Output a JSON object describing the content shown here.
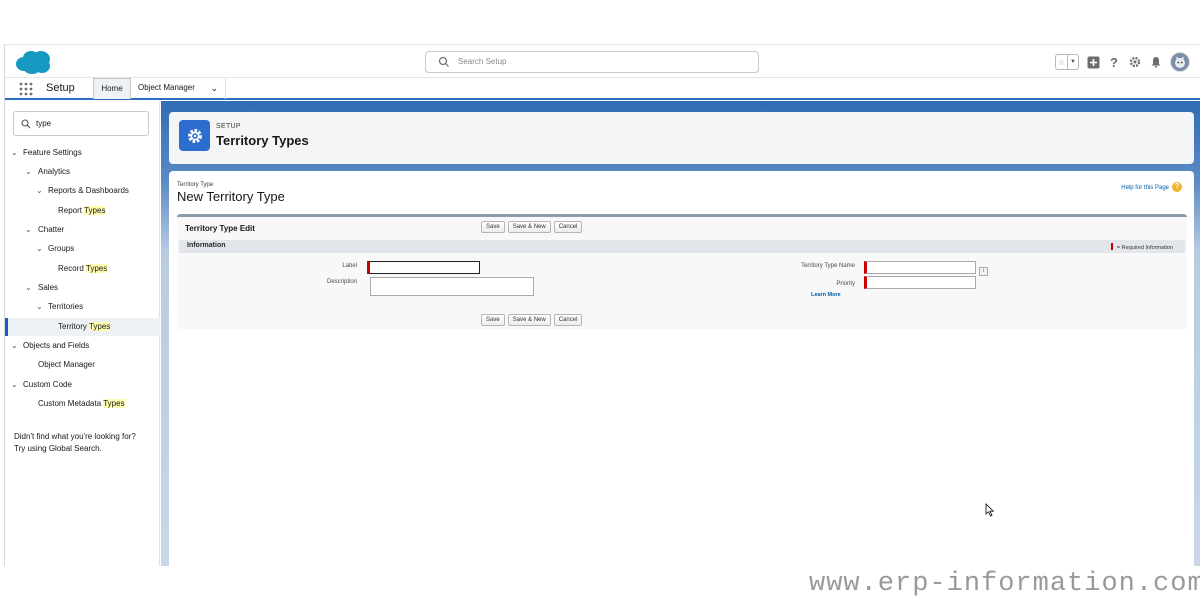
{
  "header": {
    "search_placeholder": "Search Setup",
    "icons": [
      "favorites-star-icon",
      "favorites-dropdown-icon",
      "add-icon",
      "help-icon",
      "settings-gear-icon",
      "notifications-bell-icon",
      "avatar-icon"
    ],
    "help_glyph": "?"
  },
  "context_bar": {
    "app_name": "Setup",
    "tabs": [
      {
        "label": "Home",
        "active": true
      },
      {
        "label": "Object Manager",
        "active": false
      }
    ]
  },
  "sidebar": {
    "quickfind_value": "type",
    "items": [
      {
        "text": "Feature Settings",
        "match": ""
      },
      {
        "text": "Analytics",
        "match": ""
      },
      {
        "text": "Reports & Dashboards",
        "match": ""
      },
      {
        "text": "Report ",
        "match": "Types"
      },
      {
        "text": "Chatter",
        "match": ""
      },
      {
        "text": "Groups",
        "match": ""
      },
      {
        "text": "Record ",
        "match": "Types"
      },
      {
        "text": "Sales",
        "match": ""
      },
      {
        "text": "Territories",
        "match": ""
      },
      {
        "text": "Territory ",
        "match": "Types"
      },
      {
        "text": "Objects and Fields",
        "match": ""
      },
      {
        "text": "Object Manager",
        "match": ""
      },
      {
        "text": "Custom Code",
        "match": ""
      },
      {
        "text": "Custom Metadata ",
        "match": "Types"
      }
    ],
    "not_found_line1": "Didn't find what you're looking for?",
    "not_found_line2": "Try using Global Search."
  },
  "page_header": {
    "eyebrow": "SETUP",
    "title": "Territory Types"
  },
  "record": {
    "type_label": "Territory Type",
    "title": "New Territory Type",
    "help_link": "Help for this Page"
  },
  "edit_block": {
    "title": "Territory Type Edit",
    "buttons": [
      "Save",
      "Save & New",
      "Cancel"
    ],
    "section_title": "Information",
    "required_legend": "= Required Information",
    "fields": {
      "label": {
        "label": "Label",
        "value": ""
      },
      "description": {
        "label": "Description",
        "value": ""
      },
      "type_name": {
        "label": "Territory Type Name",
        "value": ""
      },
      "priority": {
        "label": "Priority",
        "value": ""
      }
    },
    "learn_more": "Learn More",
    "info_glyph": "i"
  },
  "watermark": "www.erp-information.com",
  "colors": {
    "brand_blue": "#2e6dd0",
    "required_red": "#cc0000",
    "link_blue": "#015ba7",
    "highlight": "#fffcb0"
  }
}
